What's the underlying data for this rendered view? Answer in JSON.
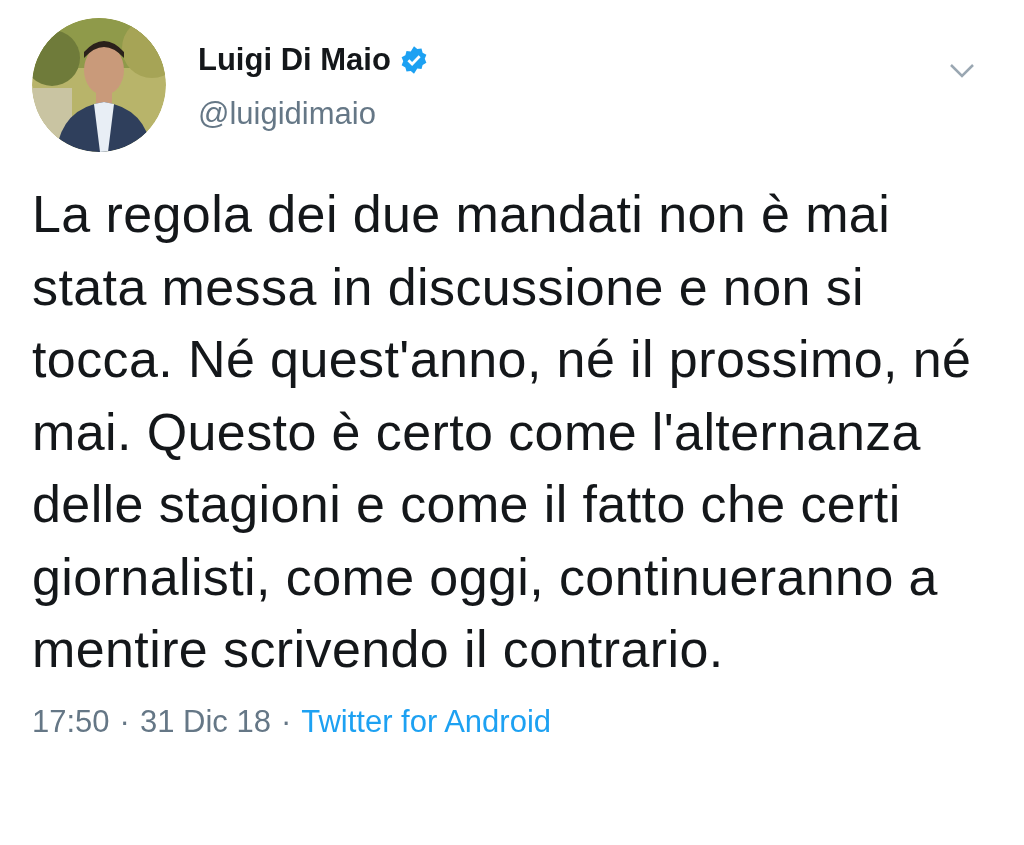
{
  "author": {
    "name": "Luigi Di Maio",
    "verified": true,
    "handle": "@luigidimaio"
  },
  "tweet": {
    "text": "La regola dei due mandati non è mai stata messa in discussione e non si tocca. Né quest'anno, né il prossimo, né mai. Questo è certo come l'alternanza delle stagioni e come il fatto che certi giornalisti, come oggi, continueranno a mentire scrivendo il contrario."
  },
  "meta": {
    "time": "17:50",
    "separator_1": "·",
    "date": "31 Dic 18",
    "separator_2": "·",
    "source": "Twitter for Android"
  }
}
